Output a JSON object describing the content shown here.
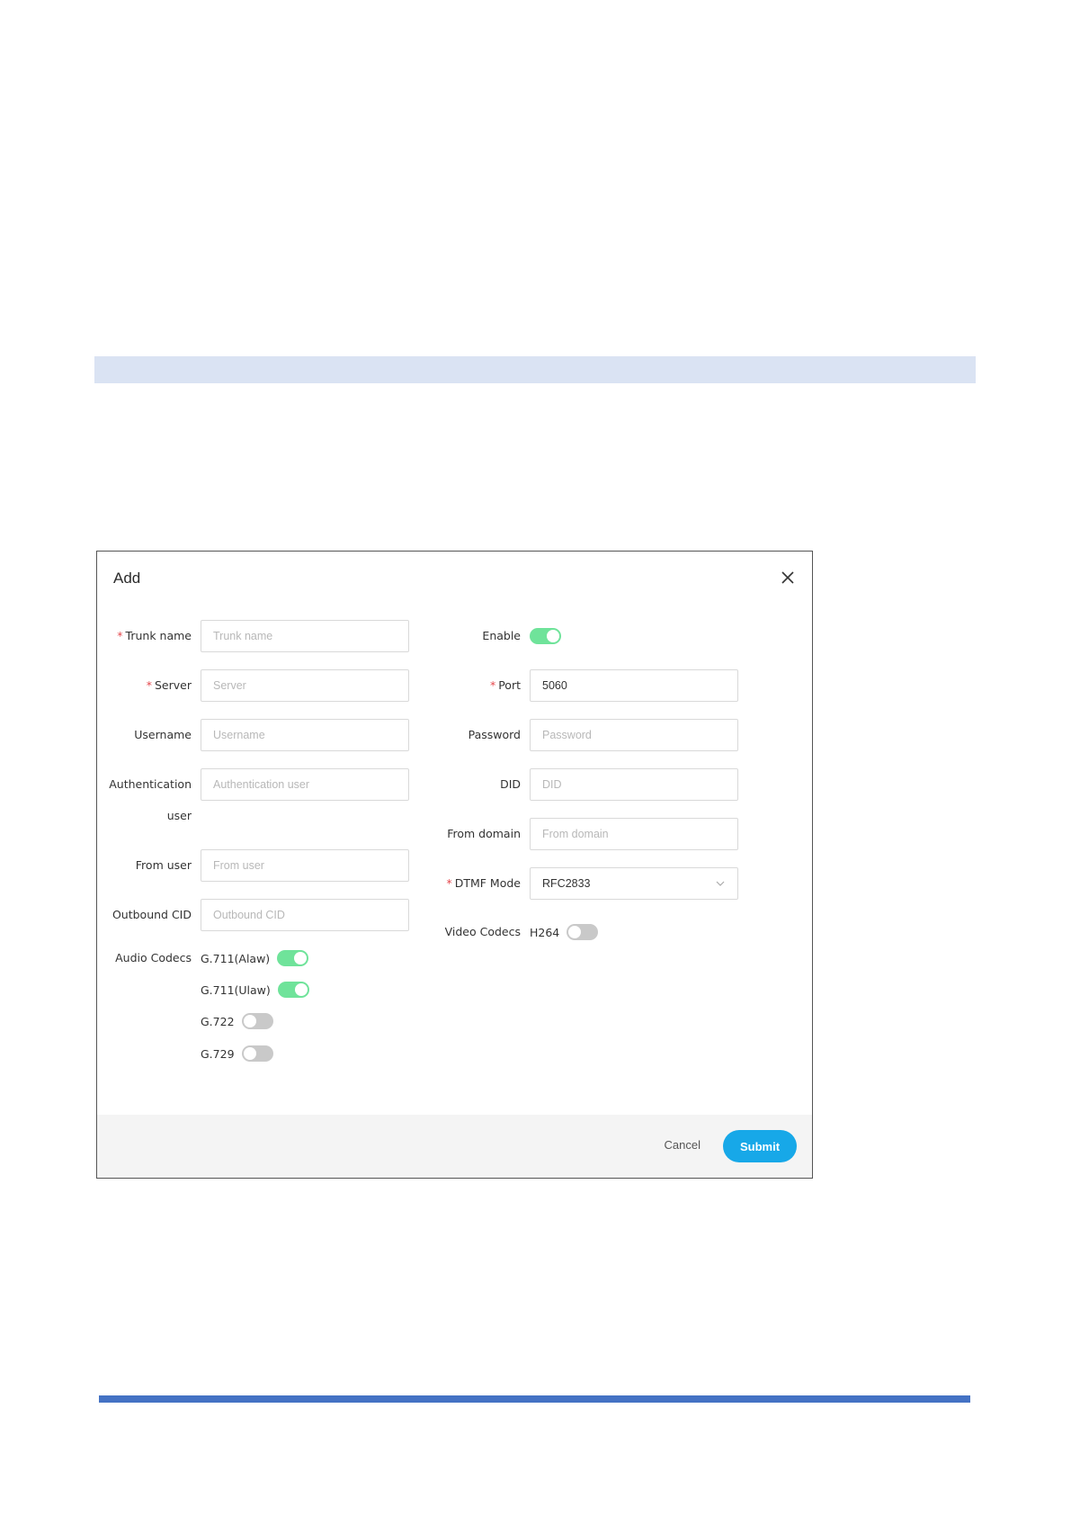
{
  "dialog": {
    "title": "Add",
    "cancel_label": "Cancel",
    "submit_label": "Submit"
  },
  "form": {
    "trunk_name": {
      "label": "Trunk name",
      "placeholder": "Trunk name",
      "value": ""
    },
    "server": {
      "label": "Server",
      "placeholder": "Server",
      "value": ""
    },
    "username": {
      "label": "Username",
      "placeholder": "Username",
      "value": ""
    },
    "auth_user": {
      "label_line1": "Authentication",
      "label_line2": "user",
      "placeholder": "Authentication user",
      "value": ""
    },
    "from_user": {
      "label": "From user",
      "placeholder": "From user",
      "value": ""
    },
    "outbound_cid": {
      "label": "Outbound CID",
      "placeholder": "Outbound CID",
      "value": ""
    },
    "enable": {
      "label": "Enable",
      "on": true
    },
    "port": {
      "label": "Port",
      "placeholder": "",
      "value": "5060"
    },
    "password": {
      "label": "Password",
      "placeholder": "Password",
      "value": ""
    },
    "did": {
      "label": "DID",
      "placeholder": "DID",
      "value": ""
    },
    "from_domain": {
      "label": "From domain",
      "placeholder": "From domain",
      "value": ""
    },
    "dtmf_mode": {
      "label": "DTMF Mode",
      "selected": "RFC2833"
    },
    "required_mark": "*",
    "audio_codecs": {
      "label": "Audio Codecs",
      "items": [
        {
          "name": "G.711(Alaw)",
          "on": true
        },
        {
          "name": "G.711(Ulaw)",
          "on": true
        },
        {
          "name": "G.722",
          "on": false
        },
        {
          "name": "G.729",
          "on": false
        }
      ]
    },
    "video_codecs": {
      "label": "Video Codecs",
      "items": [
        {
          "name": "H264",
          "on": false
        }
      ]
    }
  },
  "colors": {
    "toggle_on": "#6fe39a",
    "toggle_off": "#c9c9c9",
    "primary": "#17a8e8",
    "required": "#e5484d",
    "shade_band": "#dae3f3",
    "footer_rule": "#4472c4"
  },
  "icons": {
    "close": "close-icon",
    "dropdown": "chevron-down-icon"
  }
}
